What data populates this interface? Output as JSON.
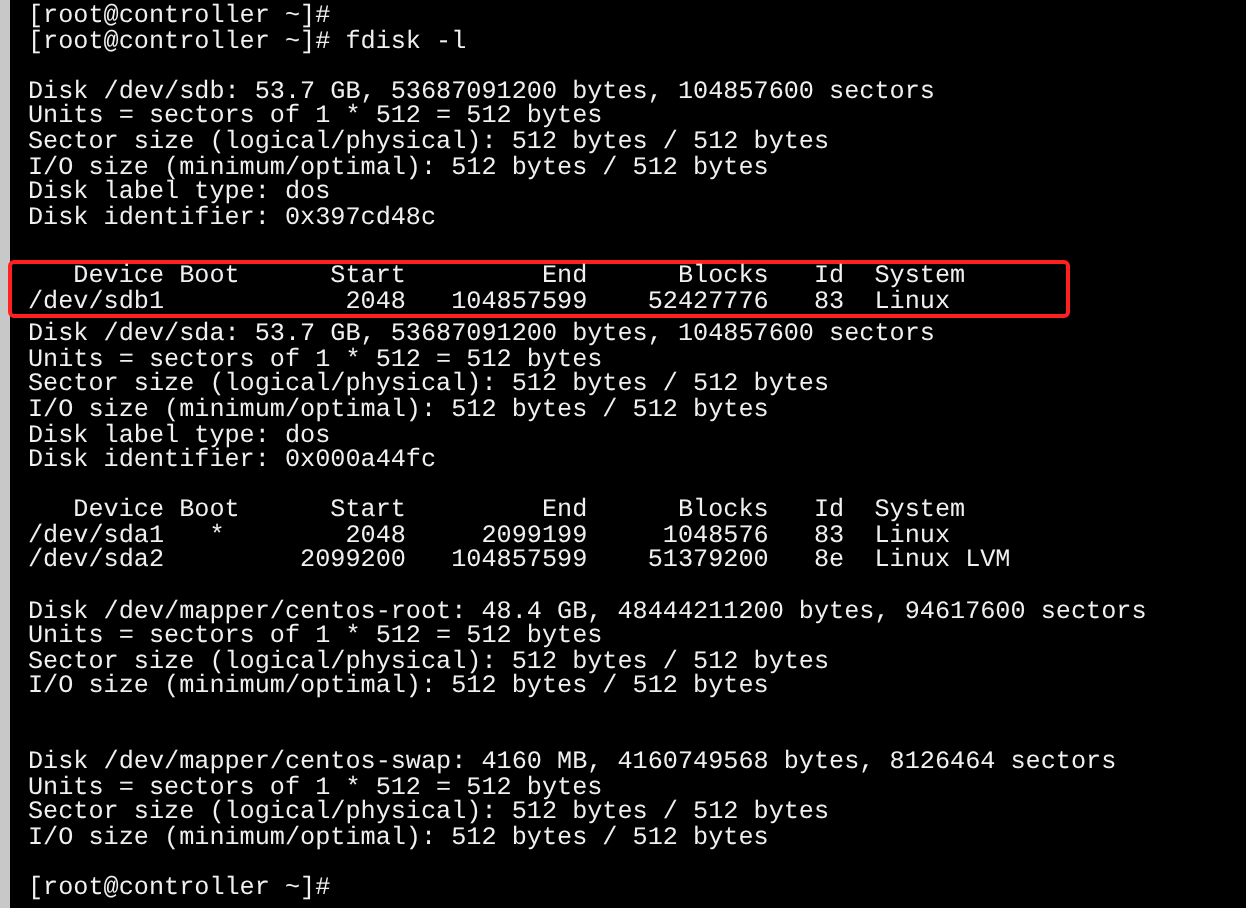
{
  "terminal": {
    "blocks": [
      {
        "highlighted": false,
        "lines": [
          {
            "kind": "prompt",
            "text": "[root@controller ~]#"
          },
          {
            "kind": "prompt",
            "text": "[root@controller ~]# fdisk -l"
          },
          {
            "kind": "blank"
          },
          {
            "kind": "output",
            "text": "Disk /dev/sdb: 53.7 GB, 53687091200 bytes, 104857600 sectors"
          },
          {
            "kind": "output",
            "text": "Units = sectors of 1 * 512 = 512 bytes"
          },
          {
            "kind": "output",
            "text": "Sector size (logical/physical): 512 bytes / 512 bytes"
          },
          {
            "kind": "output",
            "text": "I/O size (minimum/optimal): 512 bytes / 512 bytes"
          },
          {
            "kind": "output",
            "text": "Disk label type: dos"
          },
          {
            "kind": "output",
            "text": "Disk identifier: 0x397cd48c"
          },
          {
            "kind": "blank"
          }
        ]
      },
      {
        "highlighted": true,
        "lines": [
          {
            "kind": "output",
            "text": "   Device Boot      Start         End      Blocks   Id  System"
          },
          {
            "kind": "output",
            "text": "/dev/sdb1            2048   104857599    52427776   83  Linux"
          }
        ]
      },
      {
        "highlighted": false,
        "lines": [
          {
            "kind": "output",
            "text": "Disk /dev/sda: 53.7 GB, 53687091200 bytes, 104857600 sectors"
          },
          {
            "kind": "output",
            "text": "Units = sectors of 1 * 512 = 512 bytes"
          },
          {
            "kind": "output",
            "text": "Sector size (logical/physical): 512 bytes / 512 bytes"
          },
          {
            "kind": "output",
            "text": "I/O size (minimum/optimal): 512 bytes / 512 bytes"
          },
          {
            "kind": "output",
            "text": "Disk label type: dos"
          },
          {
            "kind": "output",
            "text": "Disk identifier: 0x000a44fc"
          },
          {
            "kind": "blank"
          },
          {
            "kind": "output",
            "text": "   Device Boot      Start         End      Blocks   Id  System"
          },
          {
            "kind": "output",
            "text": "/dev/sda1   *        2048     2099199     1048576   83  Linux"
          },
          {
            "kind": "output",
            "text": "/dev/sda2         2099200   104857599    51379200   8e  Linux LVM"
          },
          {
            "kind": "blank"
          },
          {
            "kind": "output",
            "text": "Disk /dev/mapper/centos-root: 48.4 GB, 48444211200 bytes, 94617600 sectors"
          },
          {
            "kind": "output",
            "text": "Units = sectors of 1 * 512 = 512 bytes"
          },
          {
            "kind": "output",
            "text": "Sector size (logical/physical): 512 bytes / 512 bytes"
          },
          {
            "kind": "output",
            "text": "I/O size (minimum/optimal): 512 bytes / 512 bytes"
          },
          {
            "kind": "blank"
          },
          {
            "kind": "blank"
          },
          {
            "kind": "output",
            "text": "Disk /dev/mapper/centos-swap: 4160 MB, 4160749568 bytes, 8126464 sectors"
          },
          {
            "kind": "output",
            "text": "Units = sectors of 1 * 512 = 512 bytes"
          },
          {
            "kind": "output",
            "text": "Sector size (logical/physical): 512 bytes / 512 bytes"
          },
          {
            "kind": "output",
            "text": "I/O size (minimum/optimal): 512 bytes / 512 bytes"
          },
          {
            "kind": "blank"
          },
          {
            "kind": "prompt",
            "text": "[root@controller ~]#"
          }
        ]
      }
    ]
  }
}
